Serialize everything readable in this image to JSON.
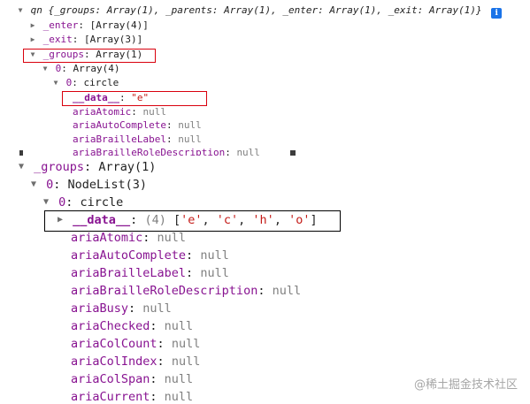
{
  "top_panel": {
    "summary": {
      "name": "qn",
      "text": "{_groups: Array(1), _parents: Array(1), _enter: Array(1), _exit: Array(1)}",
      "info_icon": "info-icon"
    },
    "enter": {
      "key": "_enter",
      "value": "[Array(4)]"
    },
    "exit": {
      "key": "_exit",
      "value": "[Array(3)]"
    },
    "groups": {
      "key": "_groups",
      "value": "Array(1)"
    },
    "item0": {
      "key": "0",
      "value": "Array(4)"
    },
    "item00": {
      "key": "0",
      "value": "circle"
    },
    "data": {
      "key": "__data__",
      "value": "\"e\""
    },
    "props": [
      {
        "key": "ariaAtomic",
        "value": "null"
      },
      {
        "key": "ariaAutoComplete",
        "value": "null"
      },
      {
        "key": "ariaBrailleLabel",
        "value": "null"
      },
      {
        "key": "ariaBrailleRoleDescription",
        "value": "null"
      }
    ]
  },
  "bottom_panel": {
    "groups": {
      "key": "_groups",
      "value": "Array(1)"
    },
    "item0": {
      "key": "0",
      "value": "NodeList(3)"
    },
    "item00": {
      "key": "0",
      "value": "circle"
    },
    "data": {
      "key": "__data__",
      "count": "(4)",
      "open": "[",
      "values": [
        "'e'",
        "'c'",
        "'h'",
        "'o'"
      ],
      "sep": ", ",
      "close": "]"
    },
    "props": [
      {
        "key": "ariaAtomic",
        "value": "null"
      },
      {
        "key": "ariaAutoComplete",
        "value": "null"
      },
      {
        "key": "ariaBrailleLabel",
        "value": "null"
      },
      {
        "key": "ariaBrailleRoleDescription",
        "value": "null"
      },
      {
        "key": "ariaBusy",
        "value": "null"
      },
      {
        "key": "ariaChecked",
        "value": "null"
      },
      {
        "key": "ariaColCount",
        "value": "null"
      },
      {
        "key": "ariaColIndex",
        "value": "null"
      },
      {
        "key": "ariaColSpan",
        "value": "null"
      },
      {
        "key": "ariaCurrent",
        "value": "null"
      }
    ]
  },
  "watermark": "@稀土掘金技术社区",
  "colors": {
    "key": "#881391",
    "string": "#c41a16",
    "null": "#808080",
    "highlight_red": "#d9000d",
    "highlight_black": "#000000",
    "info_blue": "#1a73e8"
  }
}
